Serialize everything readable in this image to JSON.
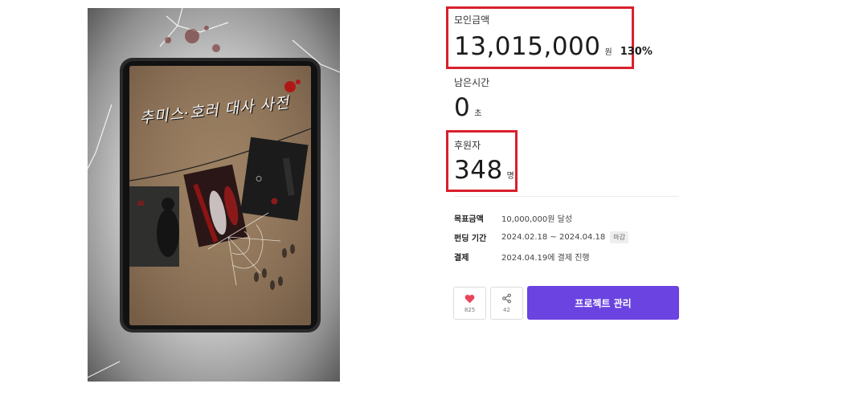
{
  "cover": {
    "title_text": "추미스·호러 대사 사전"
  },
  "stats": {
    "amount": {
      "label": "모인금액",
      "value": "13,015,000",
      "unit": "원",
      "percent": "130%"
    },
    "time": {
      "label": "남은시간",
      "value": "0",
      "unit": "초"
    },
    "backers": {
      "label": "후원자",
      "value": "348",
      "unit": "명"
    }
  },
  "info": {
    "goal": {
      "label": "목표금액",
      "value": "10,000,000원 달성"
    },
    "period": {
      "label": "펀딩 기간",
      "value": "2024.02.18 ~ 2024.04.18",
      "tag": "마감"
    },
    "payment": {
      "label": "결제",
      "value": "2024.04.19에 결제 진행"
    }
  },
  "actions": {
    "like_count": "825",
    "share_count": "42",
    "manage_label": "프로젝트 관리"
  },
  "colors": {
    "highlight": "#d8202c",
    "primary_button": "#6a43e0",
    "heart": "#e8455a"
  },
  "icons": [
    "heart-icon",
    "share-icon"
  ]
}
